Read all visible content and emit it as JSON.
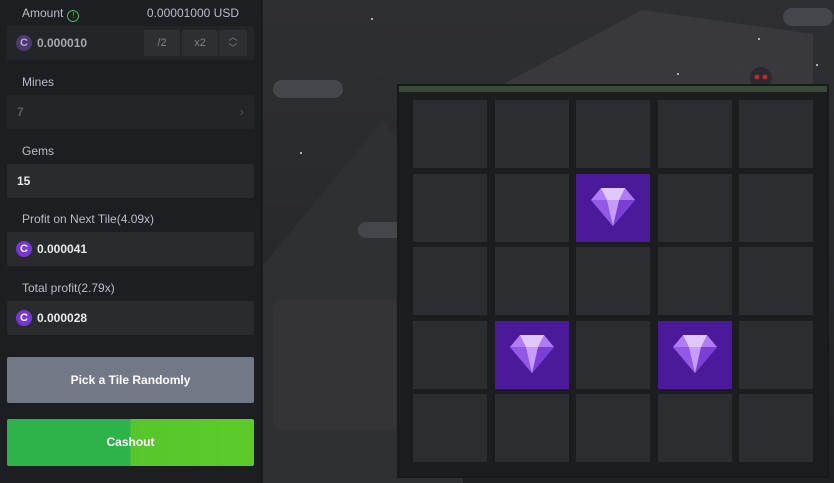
{
  "amount": {
    "label": "Amount",
    "usd_value": "0.00001000 USD",
    "value": "0.000010",
    "half_label": "/2",
    "double_label": "x2",
    "coin_symbol": "C"
  },
  "mines": {
    "label": "Mines",
    "value": "7",
    "chevron": "›"
  },
  "gems": {
    "label": "Gems",
    "value": "15"
  },
  "profit_next": {
    "label": "Profit on Next Tile(4.09x)",
    "value": "0.000041",
    "coin_symbol": "C"
  },
  "total_profit": {
    "label": "Total profit(2.79x)",
    "value": "0.000028",
    "coin_symbol": "C"
  },
  "buttons": {
    "pick_random": "Pick a Tile Randomly",
    "cashout": "Cashout"
  },
  "board": {
    "rows": 5,
    "cols": 5,
    "revealed_gems": [
      [
        1,
        2
      ],
      [
        3,
        1
      ],
      [
        3,
        3
      ]
    ]
  },
  "colors": {
    "cashout_green": "#2db34a",
    "gem_tile": "#4b1a9a",
    "coin_purple": "#7a35d6"
  }
}
